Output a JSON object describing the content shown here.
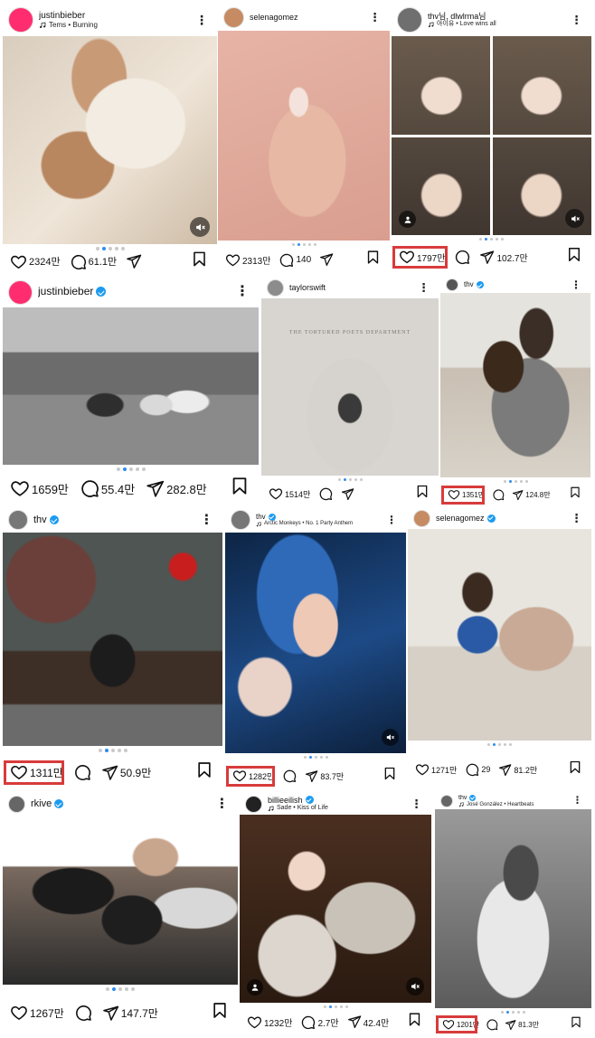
{
  "colors": {
    "highlight": "#d83b3b",
    "verified": "#1d9bf0",
    "dot_active": "#2d8cf0"
  },
  "posts": [
    {
      "username": "justinbieber",
      "music": "Tems • Burning",
      "likes": "2324만",
      "comments": "61.1만",
      "shares": ""
    },
    {
      "username": "selenagomez",
      "music": "",
      "likes": "2313만",
      "comments": "140",
      "shares": ""
    },
    {
      "username": "thv님, dlwlrma님",
      "music": "아이유 • Love wins all",
      "likes": "1797만",
      "comments": "",
      "shares": "102.7만"
    },
    {
      "username": "justinbieber",
      "music": "",
      "likes": "1659만",
      "comments": "55.4만",
      "shares": "282.8만"
    },
    {
      "username": "taylorswift",
      "music": "",
      "likes": "1514만",
      "comments": "",
      "shares": "",
      "album_text": "THE TORTURED POETS DEPARTMENT"
    },
    {
      "username": "thv",
      "music": "",
      "likes": "1351만",
      "comments": "",
      "shares": "124.8만"
    },
    {
      "username": "thv",
      "music": "",
      "likes": "1311만",
      "comments": "",
      "shares": "50.9만"
    },
    {
      "username": "thv",
      "music": "Arctic Monkeys • No. 1 Party Anthem",
      "likes": "1282만",
      "comments": "",
      "shares": "83.7만"
    },
    {
      "username": "selenagomez",
      "music": "",
      "likes": "1271만",
      "comments": "29",
      "shares": "81.2만"
    },
    {
      "username": "rkive",
      "music": "",
      "likes": "1267만",
      "comments": "",
      "shares": "147.7만"
    },
    {
      "username": "billieeilish",
      "music": "Sade • Kiss of Life",
      "likes": "1232만",
      "comments": "2.7만",
      "shares": "42.4만"
    },
    {
      "username": "thv",
      "music": "José González • Heartbeats",
      "likes": "1201만",
      "comments": "",
      "shares": "81.3만"
    }
  ]
}
